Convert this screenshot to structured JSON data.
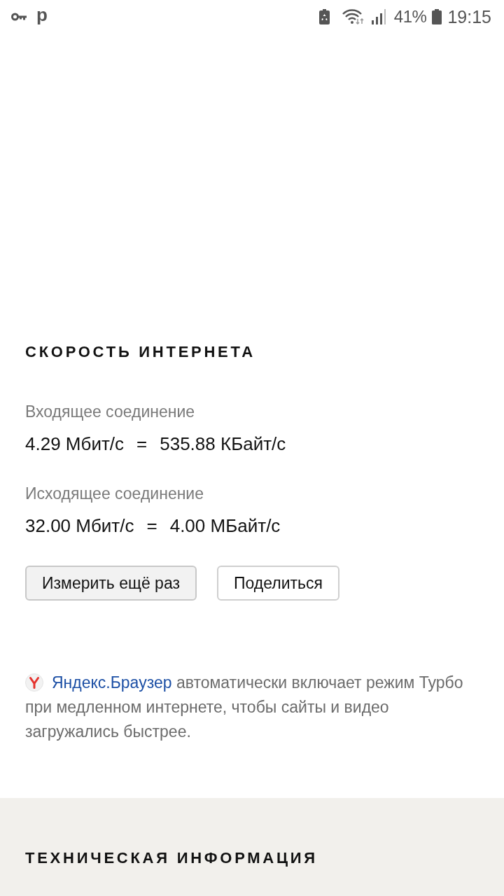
{
  "status_bar": {
    "notification_glyph": "p",
    "battery_percent": "41%",
    "time": "19:15"
  },
  "speed": {
    "title": "СКОРОСТЬ ИНТЕРНЕТА",
    "connections": [
      {
        "label": "Входящее соединение",
        "bits": "4.29 Мбит/с",
        "equals": "=",
        "bytes": "535.88 КБайт/с"
      },
      {
        "label": "Исходящее соединение",
        "bits": "32.00 Мбит/с",
        "equals": "=",
        "bytes": "4.00 МБайт/с"
      }
    ],
    "buttons": [
      {
        "label": "Измерить ещё раз",
        "kind": "filled"
      },
      {
        "label": "Поделиться",
        "kind": "outline"
      }
    ]
  },
  "promo": {
    "link": "Яндекс.Браузер",
    "text": "автоматически включает режим Турбо при медленном интернете, чтобы сайты и видео загружались быстрее."
  },
  "tech": {
    "title": "ТЕХНИЧЕСКАЯ ИНФОРМАЦИЯ"
  }
}
